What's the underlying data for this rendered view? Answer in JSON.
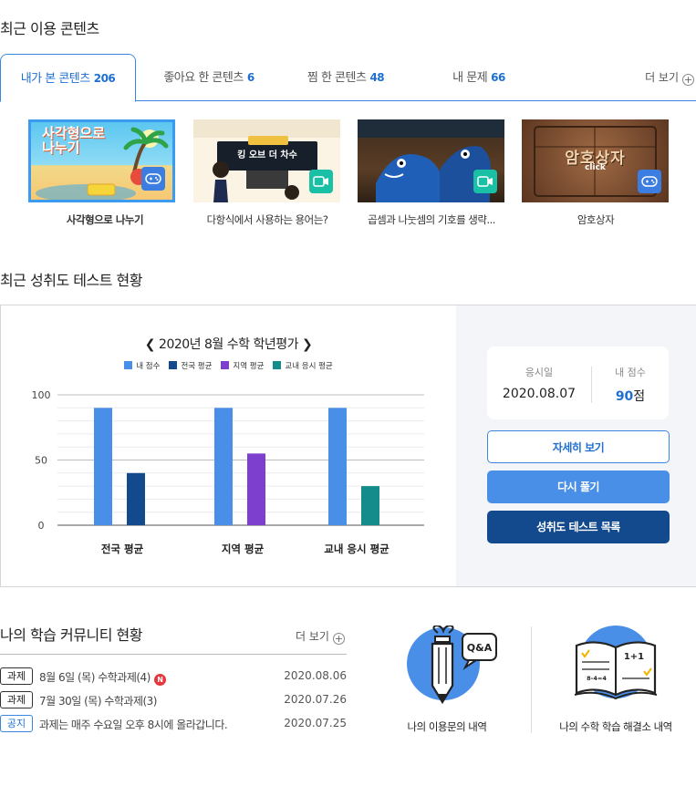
{
  "recent": {
    "title": "최근 이용 콘텐츠",
    "tabs": [
      {
        "label": "내가 본 콘텐츠",
        "count": "206"
      },
      {
        "label": "좋아요 한 콘텐츠",
        "count": "6"
      },
      {
        "label": "찜 한 콘텐츠",
        "count": "48"
      },
      {
        "label": "내 문제",
        "count": "66"
      }
    ],
    "more_label": "더 보기",
    "items": [
      {
        "caption": "사각형으로 나누기",
        "art_text": "사각형으로 나누기",
        "icon": "game-controller-icon"
      },
      {
        "caption": "다항식에서 사용하는 용어는?",
        "art_text": "킹 오브 더 차수",
        "icon": "video-play-icon"
      },
      {
        "caption": "곱셈과 나눗셈의 기호를 생략...",
        "art_text": "",
        "icon": "video-play-icon"
      },
      {
        "caption": "암호상자",
        "art_text": "암호상자",
        "art_sub": "click",
        "icon": "game-controller-icon"
      }
    ]
  },
  "test": {
    "title": "최근 성취도 테스트 현황",
    "chart_title": "2020년 8월 수학 학년평가",
    "info": {
      "date_label": "응시일",
      "date_value": "2020.08.07",
      "score_label": "내 점수",
      "score_value": "90",
      "score_unit": "점"
    },
    "buttons": {
      "detail": "자세히 보기",
      "retry": "다시 풀기",
      "list": "성취도 테스트 목록"
    }
  },
  "chart_data": {
    "type": "bar",
    "title": "2020년 8월 수학 학년평가",
    "categories": [
      "전국 평균",
      "지역 평균",
      "교내 응시 평균"
    ],
    "ylim": [
      0,
      100
    ],
    "yticks": [
      0,
      50,
      100
    ],
    "grid": true,
    "legend_position": "top",
    "legend": [
      {
        "name": "내 점수",
        "color": "#4a8fe7"
      },
      {
        "name": "전국 평균",
        "color": "#134a8e"
      },
      {
        "name": "지역 평균",
        "color": "#7d3fce"
      },
      {
        "name": "교내 응시 평균",
        "color": "#158c8c"
      }
    ],
    "groups": [
      {
        "category": "전국 평균",
        "bars": [
          {
            "series": "내 점수",
            "value": 90,
            "color": "#4a8fe7"
          },
          {
            "series": "전국 평균",
            "value": 40,
            "color": "#134a8e"
          }
        ]
      },
      {
        "category": "지역 평균",
        "bars": [
          {
            "series": "내 점수",
            "value": 90,
            "color": "#4a8fe7"
          },
          {
            "series": "지역 평균",
            "value": 55,
            "color": "#7d3fce"
          }
        ]
      },
      {
        "category": "교내 응시 평균",
        "bars": [
          {
            "series": "내 점수",
            "value": 90,
            "color": "#4a8fe7"
          },
          {
            "series": "교내 응시 평균",
            "value": 30,
            "color": "#158c8c"
          }
        ]
      }
    ]
  },
  "community": {
    "title": "나의 학습 커뮤니티 현황",
    "more_label": "더 보기",
    "rows": [
      {
        "tag": "과제",
        "text": "8월 6일 (목) 수학과제(4)",
        "new": "N",
        "date": "2020.08.06"
      },
      {
        "tag": "과제",
        "text": "7월 30일 (목) 수학과제(3)",
        "date": "2020.07.26"
      },
      {
        "tag": "공지",
        "text": "과제는 매주 수요일 오후 8시에 올라갑니다.",
        "date": "2020.07.25"
      }
    ],
    "qna_icon_text": "Q&A",
    "qna_label": "나의 이용문의 내역",
    "book_icon_text": "1+1",
    "book_icon_sub": "8-4=4",
    "book_label": "나의 수학 학습 해결소 내역"
  }
}
